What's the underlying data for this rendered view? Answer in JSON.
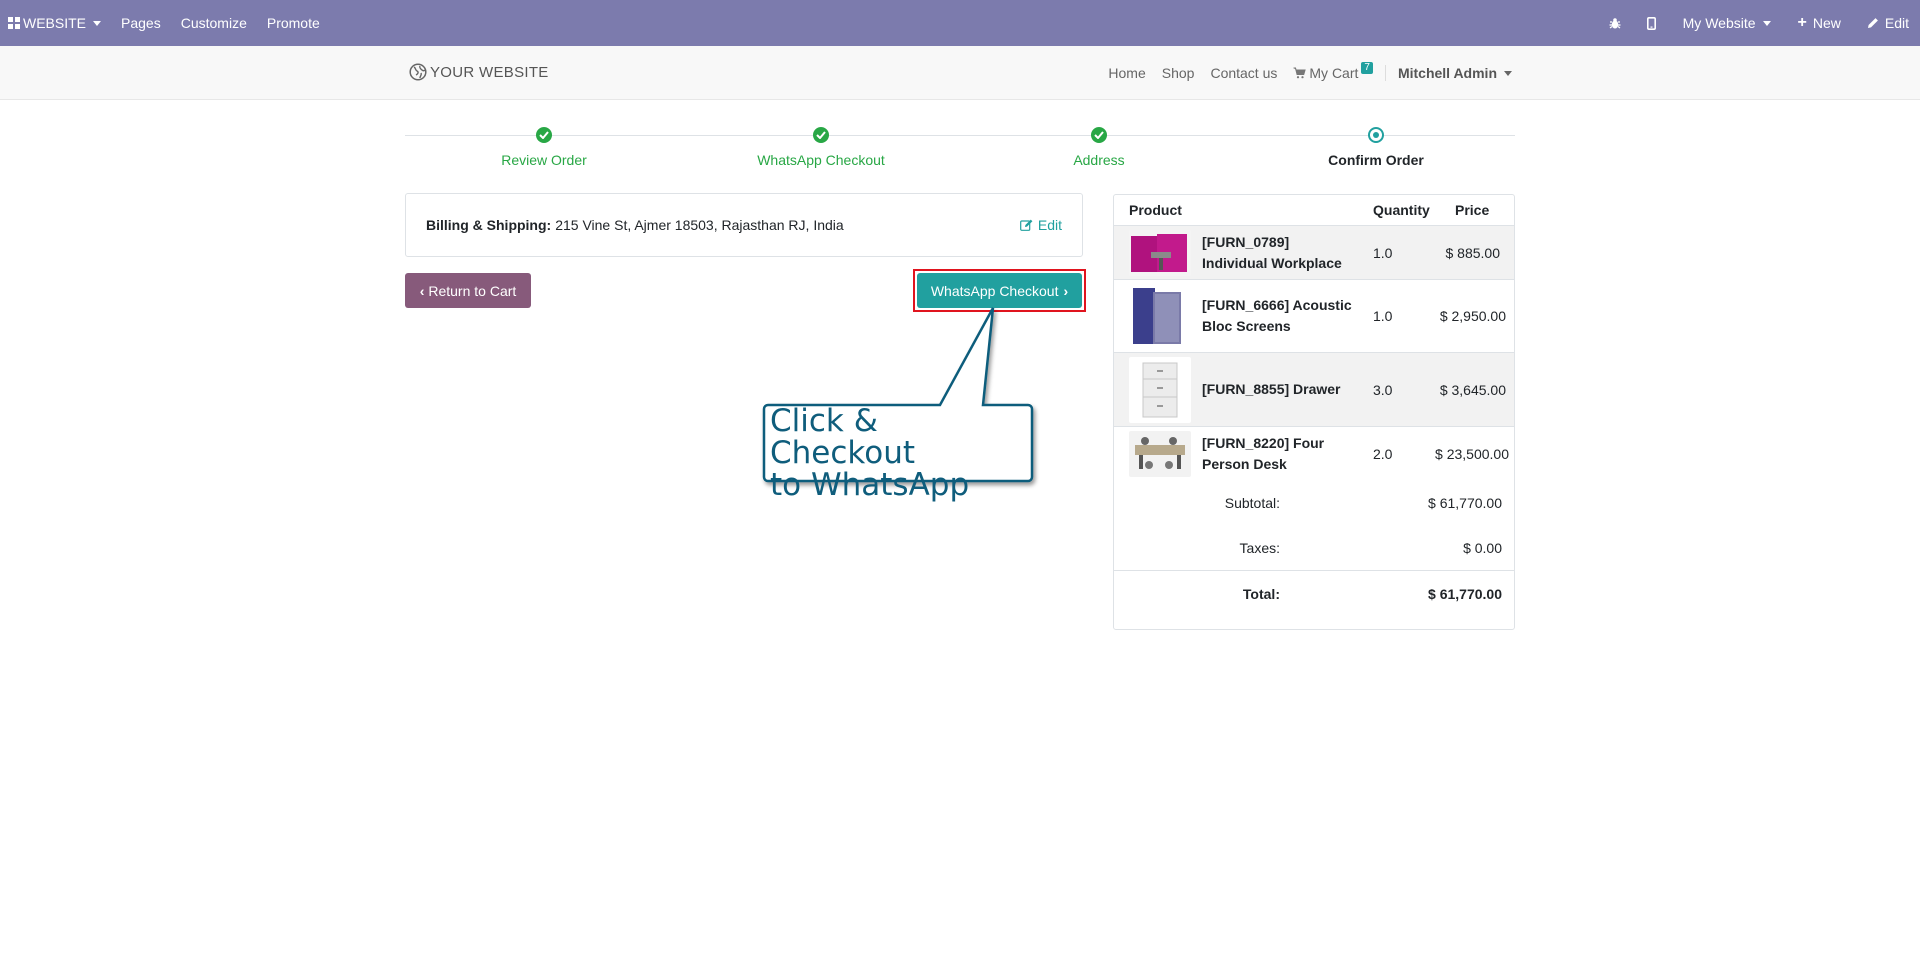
{
  "admin_bar": {
    "brand": "WEBSITE",
    "menu": [
      "Pages",
      "Customize",
      "Promote"
    ],
    "website_selector": "My Website",
    "new_label": "New",
    "edit_label": "Edit",
    "icons": [
      "bug-icon",
      "mobile-icon"
    ]
  },
  "site_nav": {
    "logo": "YOUR WEBSITE",
    "links": [
      "Home",
      "Shop",
      "Contact us"
    ],
    "cart_label": "My Cart",
    "cart_count": "7",
    "user": "Mitchell Admin"
  },
  "wizard": {
    "steps": [
      {
        "label": "Review Order",
        "state": "done"
      },
      {
        "label": "WhatsApp Checkout",
        "state": "done"
      },
      {
        "label": "Address",
        "state": "done"
      },
      {
        "label": "Confirm Order",
        "state": "current"
      }
    ]
  },
  "billing": {
    "label": "Billing & Shipping:",
    "address": "215 Vine St, Ajmer 18503, Rajasthan RJ, India",
    "edit": "Edit"
  },
  "buttons": {
    "return": "Return to Cart",
    "whatsapp": "WhatsApp Checkout"
  },
  "callout": {
    "line1": "Click & Checkout",
    "line2": "to WhatsApp"
  },
  "summary": {
    "headers": {
      "product": "Product",
      "quantity": "Quantity",
      "price": "Price"
    },
    "items": [
      {
        "name": "[FURN_0789] Individual Workplace",
        "qty": "1.0",
        "price": "$ 885.00"
      },
      {
        "name": "[FURN_6666] Acoustic Bloc Screens",
        "qty": "1.0",
        "price": "$ 2,950.00"
      },
      {
        "name": "[FURN_8855] Drawer",
        "qty": "3.0",
        "price": "$ 3,645.00"
      },
      {
        "name": "[FURN_8220] Four Person Desk",
        "qty": "2.0",
        "price": "$ 23,500.00"
      }
    ],
    "subtotal_label": "Subtotal:",
    "subtotal": "$ 61,770.00",
    "taxes_label": "Taxes:",
    "taxes": "$ 0.00",
    "total_label": "Total:",
    "total": "$ 61,770.00"
  },
  "colors": {
    "admin_bar": "#7c7bad",
    "accent": "#21a09f",
    "success": "#28a745",
    "return_button": "#875a7b",
    "highlight": "#e0141e"
  }
}
